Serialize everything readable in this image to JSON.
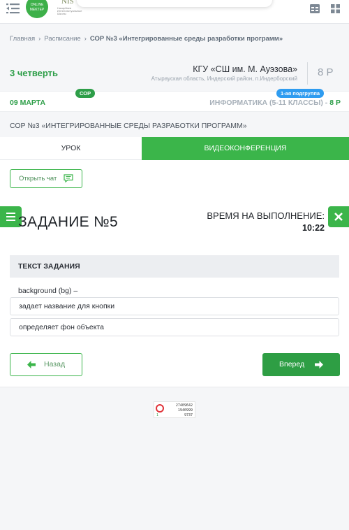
{
  "header": {
    "logo_online_text": "ONLINE MEKTEP",
    "logo_nis_text": "NIS",
    "logo_nis_sub": "Назарбаев Интеллектуальные Школы"
  },
  "breadcrumb": {
    "home": "Главная",
    "schedule": "Расписание",
    "current": "СОР №3 «Интегрированные среды разработки программ»"
  },
  "school": {
    "quarter": "3 четверть",
    "name": "КГУ «СШ им. М. Ауэзова»",
    "location": "Атырауская область, Индерский район, п.Индерборский",
    "grade": "8 Р"
  },
  "lesson_info": {
    "date": "09 МАРТА",
    "badge": "СОР",
    "subject": "ИНФОРМАТИКА (5-11 КЛАССЫ) - ",
    "subject_grade": "8 Р",
    "subgroup": "1-ая подгруппа"
  },
  "page_title": "СОР №3 «ИНТЕГРИРОВАННЫЕ СРЕДЫ РАЗРАБОТКИ ПРОГРАММ»",
  "tabs": {
    "lesson": "УРОК",
    "video": "ВИДЕОКОНФЕРЕНЦИЯ"
  },
  "chat_button": "Открыть чат",
  "task": {
    "title": "ЗАДАНИЕ №5",
    "time_label": "ВРЕМЯ НА ВЫПОЛНЕНИЕ:",
    "time_value": "10:22",
    "text_header": "ТЕКСТ ЗАДАНИЯ",
    "question": "background (bg) –",
    "options": [
      "задает название для кнопки",
      "определяет фон объекта"
    ]
  },
  "nav": {
    "back": "Назад",
    "next": "Вперед"
  },
  "counter": {
    "line1": "27409642",
    "line2": "1940999",
    "line3": "9737",
    "small": "1"
  },
  "colors": {
    "accent_green": "#3bb54a",
    "badge_blue": "#2f9cf0",
    "text_dark": "#1f2328"
  }
}
